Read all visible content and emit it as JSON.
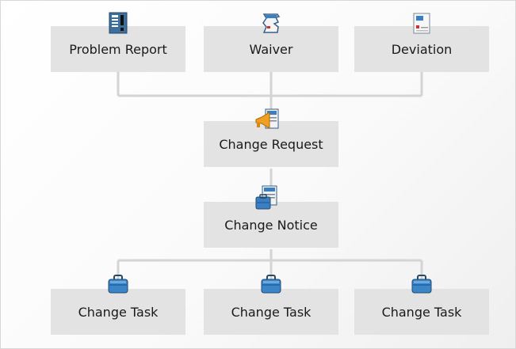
{
  "nodes": {
    "problem_report": {
      "label": "Problem Report",
      "icon": "problem-report-icon"
    },
    "waiver": {
      "label": "Waiver",
      "icon": "waiver-icon"
    },
    "deviation": {
      "label": "Deviation",
      "icon": "deviation-icon"
    },
    "change_request": {
      "label": "Change Request",
      "icon": "change-request-icon"
    },
    "change_notice": {
      "label": "Change Notice",
      "icon": "change-notice-icon"
    },
    "change_tasks": [
      {
        "label": "Change Task",
        "icon": "briefcase-icon"
      },
      {
        "label": "Change Task",
        "icon": "briefcase-icon"
      },
      {
        "label": "Change Task",
        "icon": "briefcase-icon"
      }
    ]
  },
  "colors": {
    "box": "#e3e3e3",
    "connector": "#d4d4d4",
    "icon_blue": "#3a7fc1",
    "icon_red": "#d23030",
    "icon_orange": "#f0a020"
  }
}
